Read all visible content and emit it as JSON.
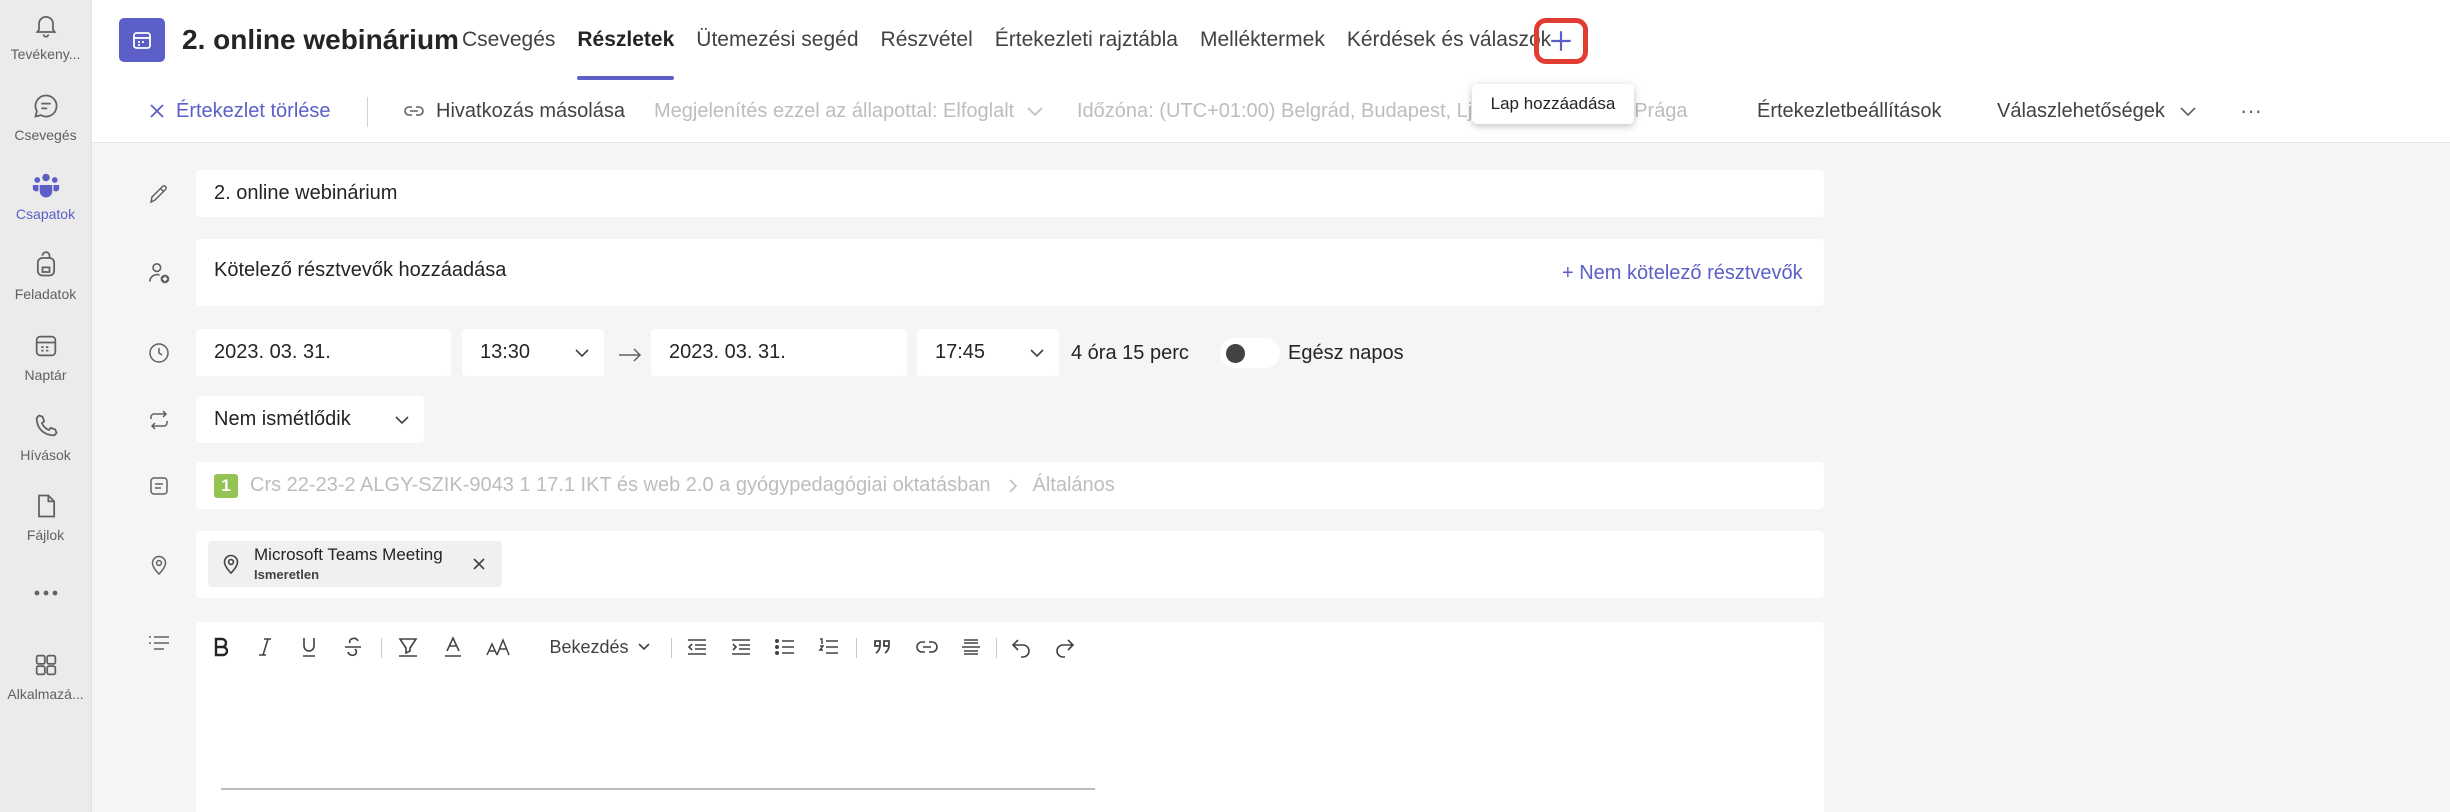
{
  "rail": {
    "items": [
      {
        "label": "Tevékeny...",
        "icon": "bell-icon"
      },
      {
        "label": "Csevegés",
        "icon": "chat-icon"
      },
      {
        "label": "Csapatok",
        "icon": "teams-icon"
      },
      {
        "label": "Feladatok",
        "icon": "backpack-icon"
      },
      {
        "label": "Naptár",
        "icon": "calendar-icon"
      },
      {
        "label": "Hívások",
        "icon": "phone-icon"
      },
      {
        "label": "Fájlok",
        "icon": "file-icon"
      },
      {
        "label": "",
        "icon": "more-icon"
      },
      {
        "label": "Alkalmazá...",
        "icon": "apps-icon"
      }
    ],
    "active_index": 2
  },
  "header": {
    "title": "2. online webinárium",
    "tabs": [
      "Csevegés",
      "Részletek",
      "Ütemezési segéd",
      "Részvétel",
      "Értekezleti rajztábla",
      "Melléktermek",
      "Kérdések és válaszok"
    ],
    "active_tab": 1,
    "add_tab_tooltip": "Lap hozzáadása"
  },
  "toolbar": {
    "delete_label": "Értekezlet törlése",
    "copy_link_label": "Hivatkozás másolása",
    "show_as_label": "Megjelenítés ezzel az állapottal: Elfoglalt",
    "timezone_label": "Időzóna:  (UTC+01:00) Belgrád, Budapest, Ljubljana, Pozsony, Prága",
    "settings_label": "Értekezletbeállítások",
    "response_label": "Válaszlehetőségek",
    "more_label": "···"
  },
  "form": {
    "title_value": "2. online webinárium",
    "attendees_placeholder": "Kötelező résztvevők hozzáadása",
    "optional_link": "+ Nem kötelező résztvevők",
    "start_date": "2023. 03. 31.",
    "start_time": "13:30",
    "end_date": "2023. 03. 31.",
    "end_time": "17:45",
    "duration": "4 óra 15 perc",
    "all_day_label": "Egész napos",
    "all_day_on": false,
    "recurrence": "Nem ismétlődik",
    "channel_badge": "1",
    "channel_team": "Crs 22-23-2 ALGY-SZIK-9043 1 17.1 IKT és web 2.0 a gyógypedagógiai oktatásban",
    "channel_name": "Általános",
    "location_name": "Microsoft Teams Meeting",
    "location_status": "Ismeretlen",
    "paragraph_style": "Bekezdés"
  },
  "colors": {
    "accent": "#5b5fc7",
    "highlight": "#e03c31",
    "channel_badge": "#92c353"
  }
}
